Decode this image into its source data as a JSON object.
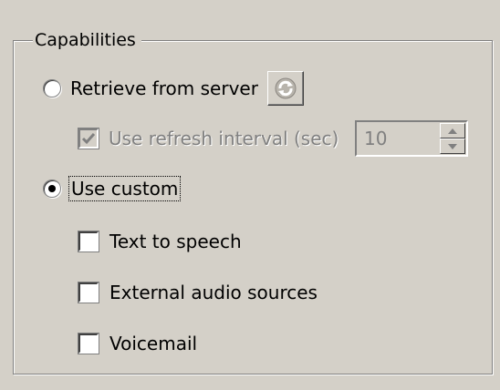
{
  "group": {
    "title": "Capabilities"
  },
  "options": {
    "retrieve_label": "Retrieve from server",
    "retrieve_selected": false,
    "refresh_icon": "refresh-arrows-icon",
    "use_refresh_label": "Use refresh interval (sec)",
    "use_refresh_checked": true,
    "use_refresh_enabled": false,
    "refresh_interval_value": "10",
    "use_custom_label": "Use custom",
    "use_custom_selected": true
  },
  "features": [
    {
      "label": "Text to speech",
      "checked": false
    },
    {
      "label": "External audio sources",
      "checked": false
    },
    {
      "label": "Voicemail",
      "checked": false
    }
  ],
  "colors": {
    "dialog_face": "#d4d0c8",
    "disabled_text": "#808080"
  }
}
